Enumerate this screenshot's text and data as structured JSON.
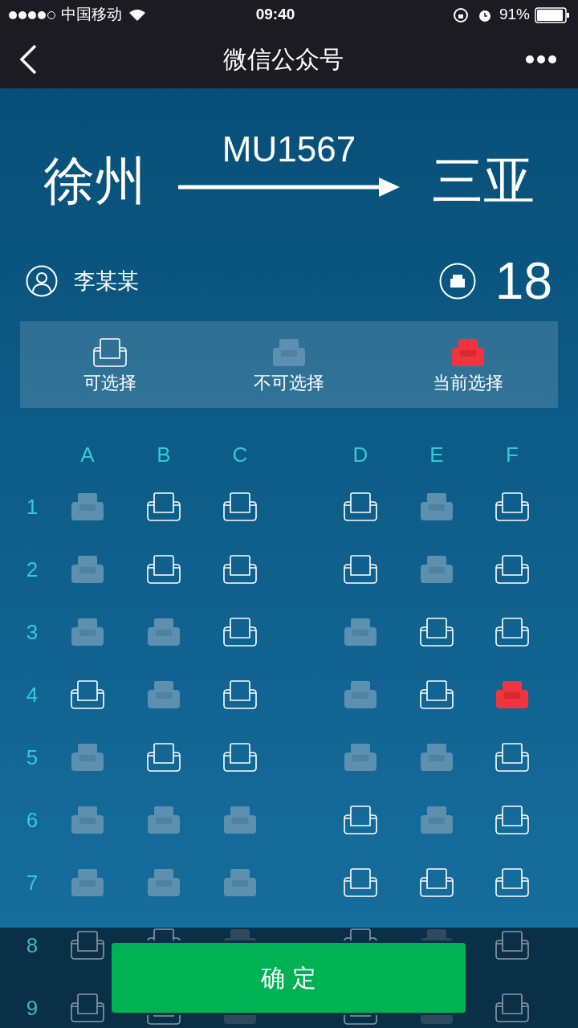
{
  "status_bar": {
    "carrier": "中国移动",
    "time": "09:40",
    "battery": "91%"
  },
  "nav": {
    "title": "微信公众号"
  },
  "flight": {
    "from": "徐州",
    "number": "MU1567",
    "to": "三亚"
  },
  "passenger": {
    "name": "李某某",
    "seat_number": "18"
  },
  "legend": [
    {
      "kind": "free",
      "label": "可选择"
    },
    {
      "kind": "taken",
      "label": "不可选择"
    },
    {
      "kind": "selected",
      "label": "当前选择"
    }
  ],
  "columns": [
    "A",
    "B",
    "C",
    "D",
    "E",
    "F"
  ],
  "rows": [
    {
      "number": "1",
      "seats": [
        {
          "kind": "taken"
        },
        {
          "kind": "free"
        },
        {
          "kind": "free"
        },
        {
          "kind": "free"
        },
        {
          "kind": "taken"
        },
        {
          "kind": "free"
        }
      ]
    },
    {
      "number": "2",
      "seats": [
        {
          "kind": "taken"
        },
        {
          "kind": "free"
        },
        {
          "kind": "free"
        },
        {
          "kind": "free"
        },
        {
          "kind": "taken"
        },
        {
          "kind": "free"
        }
      ]
    },
    {
      "number": "3",
      "seats": [
        {
          "kind": "taken"
        },
        {
          "kind": "taken"
        },
        {
          "kind": "free"
        },
        {
          "kind": "taken"
        },
        {
          "kind": "free"
        },
        {
          "kind": "free"
        }
      ]
    },
    {
      "number": "4",
      "seats": [
        {
          "kind": "free"
        },
        {
          "kind": "taken"
        },
        {
          "kind": "free"
        },
        {
          "kind": "taken"
        },
        {
          "kind": "free"
        },
        {
          "kind": "selected"
        }
      ]
    },
    {
      "number": "5",
      "seats": [
        {
          "kind": "taken"
        },
        {
          "kind": "free"
        },
        {
          "kind": "free"
        },
        {
          "kind": "taken"
        },
        {
          "kind": "taken"
        },
        {
          "kind": "free"
        }
      ]
    },
    {
      "number": "6",
      "seats": [
        {
          "kind": "taken"
        },
        {
          "kind": "taken"
        },
        {
          "kind": "taken"
        },
        {
          "kind": "free"
        },
        {
          "kind": "taken"
        },
        {
          "kind": "free"
        }
      ]
    },
    {
      "number": "7",
      "seats": [
        {
          "kind": "taken"
        },
        {
          "kind": "taken"
        },
        {
          "kind": "taken"
        },
        {
          "kind": "free"
        },
        {
          "kind": "free"
        },
        {
          "kind": "free"
        }
      ]
    },
    {
      "number": "8",
      "seats": [
        {
          "kind": "free"
        },
        {
          "kind": "free"
        },
        {
          "kind": "taken"
        },
        {
          "kind": "free"
        },
        {
          "kind": "taken"
        },
        {
          "kind": "free"
        }
      ]
    },
    {
      "number": "9",
      "seats": [
        {
          "kind": "free"
        },
        {
          "kind": "free"
        },
        {
          "kind": "taken"
        },
        {
          "kind": "free"
        },
        {
          "kind": "taken"
        },
        {
          "kind": "free"
        }
      ]
    }
  ],
  "confirm_button": "确 定"
}
